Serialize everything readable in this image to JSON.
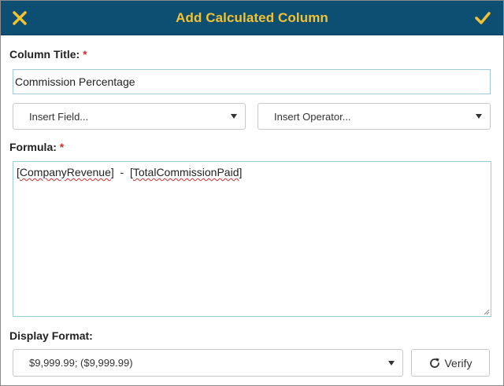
{
  "dialog": {
    "title": "Add Calculated Column",
    "close_icon": "close-x-icon",
    "confirm_icon": "checkmark-icon",
    "accent_color": "#0d4f72",
    "title_color": "#f3c232"
  },
  "column_title": {
    "label": "Column Title:",
    "required_marker": "*",
    "value": "Commission Percentage"
  },
  "insert_field": {
    "placeholder": "Insert Field..."
  },
  "insert_operator": {
    "placeholder": "Insert Operator..."
  },
  "formula": {
    "label": "Formula:",
    "required_marker": "*",
    "token_1": "CompanyRevenue",
    "token_2": "TotalCommissionPaid",
    "operator": "-",
    "open_bracket": "[",
    "close_bracket": "]"
  },
  "display_format": {
    "label": "Display Format:",
    "selected": "$9,999.99; ($9,999.99)"
  },
  "verify": {
    "label": "Verify",
    "icon": "refresh-icon"
  }
}
